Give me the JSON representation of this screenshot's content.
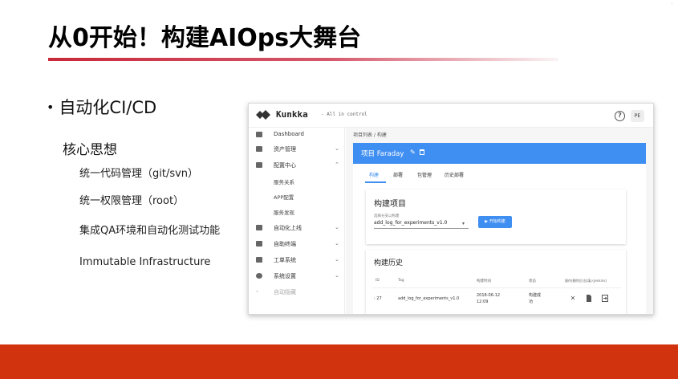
{
  "slide": {
    "title": "从0开始！构建AIOps大舞台",
    "bullet": "自动化CI/CD",
    "subheading": "核心思想",
    "points": [
      "统一代码管理（git/svn）",
      "统一权限管理（root）",
      "集成QA环境和自动化测试功能",
      "Immutable Infrastructure"
    ],
    "colors": {
      "accent_bar": "#d1330f",
      "title_rule": "#c8283a"
    }
  },
  "app": {
    "logo": "Kunkka",
    "tagline": "- All in control",
    "avatar": "PE",
    "help_icon": "question-circle-icon",
    "sidebar": {
      "items": [
        {
          "label": "Dashboard",
          "icon": "dashboard-icon"
        },
        {
          "label": "资产管理",
          "icon": "list-icon"
        },
        {
          "label": "配置中心",
          "icon": "config-icon"
        },
        {
          "label": "自动化上线",
          "icon": "grid-icon"
        },
        {
          "label": "自助终端",
          "icon": "monitor-icon"
        },
        {
          "label": "工单系统",
          "icon": "ticket-icon"
        },
        {
          "label": "系统设置",
          "icon": "gear-icon"
        },
        {
          "label": "自动隐藏",
          "icon": "chevron-left-icon"
        }
      ],
      "config_children": [
        "服务关系",
        "APP配置",
        "服务发现"
      ]
    },
    "breadcrumb": "项目列表  /  构建",
    "project_title": "项目 Faraday",
    "tabs": [
      "构建",
      "部署",
      "包管理",
      "历史部署"
    ],
    "build": {
      "title": "构建项目",
      "select_label": "选择分支以构建",
      "select_value": "add_log_for_experiments_v1.0",
      "start_button": "▶ 开始构建"
    },
    "history": {
      "title": "构建历史",
      "headers": [
        "ID",
        "Tag",
        "构建时间",
        "状态",
        "操作(删除|日志|填入Jenkins)"
      ],
      "rows": [
        {
          "id": ": 27",
          "tag": "add_log_for_experiments_v1.0",
          "time_date": "2018-06-12",
          "time_clock": "12:09",
          "status_1": "构建成",
          "status_2": "功"
        }
      ],
      "actions": [
        "close-icon",
        "file-icon",
        "export-icon"
      ]
    },
    "colors": {
      "primary": "#3f8ef1"
    }
  }
}
